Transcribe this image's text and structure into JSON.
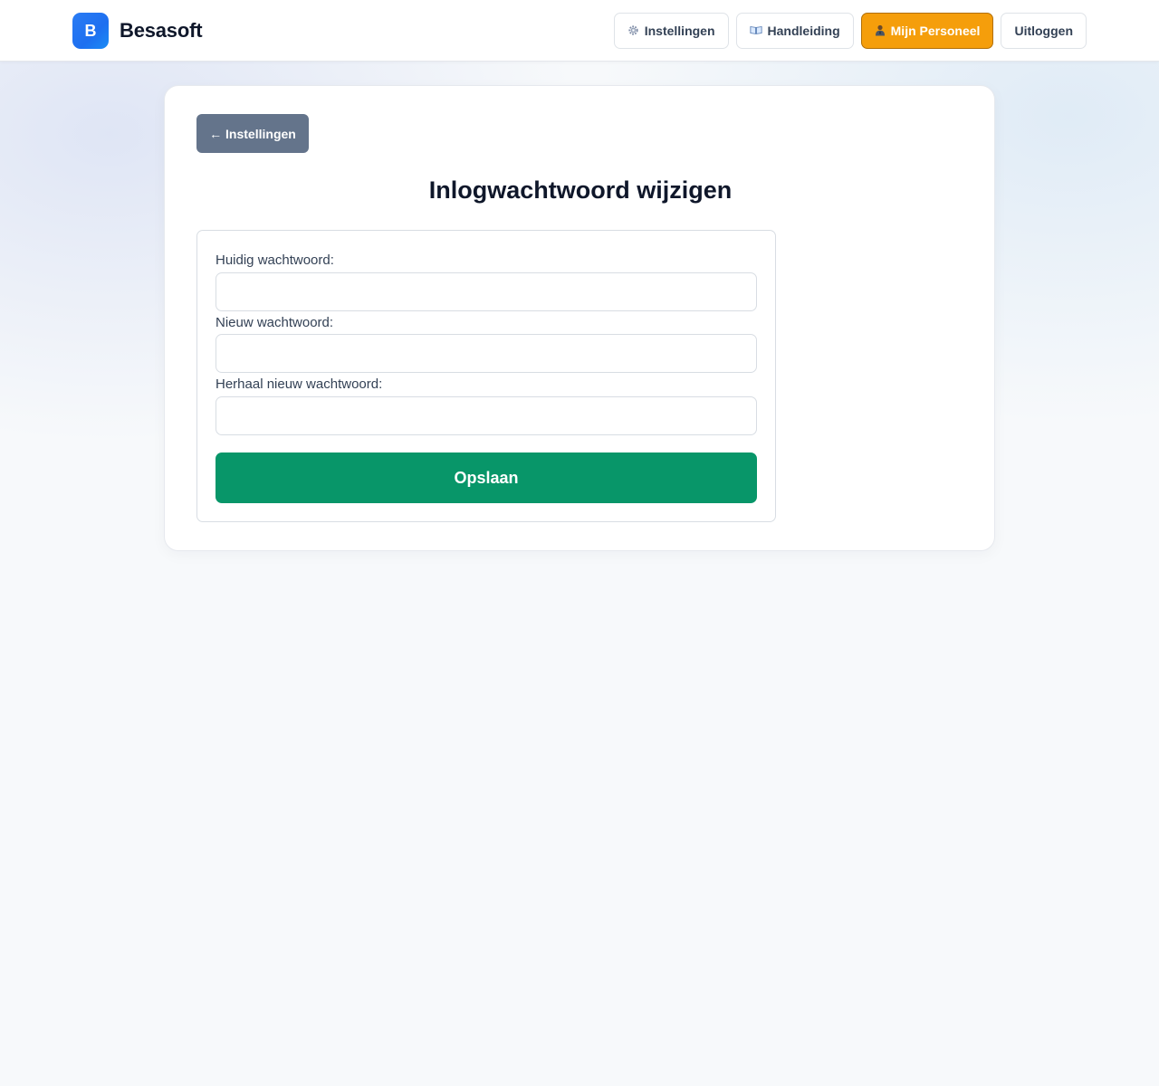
{
  "header": {
    "brand_letter": "B",
    "brand_name": "Besasoft",
    "nav": [
      {
        "label": "Instellingen",
        "icon": "gear-icon"
      },
      {
        "label": "Handleiding",
        "icon": "book-icon"
      },
      {
        "label": "Mijn Personeel",
        "icon": "person-icon"
      },
      {
        "label": "Uitloggen"
      }
    ]
  },
  "main": {
    "back_label": "← Instellingen",
    "title": "Inlogwachtwoord wijzigen",
    "form": {
      "fields": [
        {
          "label": "Huidig wachtwoord:",
          "value": ""
        },
        {
          "label": "Nieuw wachtwoord:",
          "value": ""
        },
        {
          "label": "Herhaal nieuw wachtwoord:",
          "value": ""
        }
      ],
      "submit_label": "Opslaan"
    }
  },
  "colors": {
    "brand_blue": "#1d6ff0",
    "accent_orange": "#f59e0b",
    "save_green": "#089669",
    "back_slate": "#64748b"
  }
}
